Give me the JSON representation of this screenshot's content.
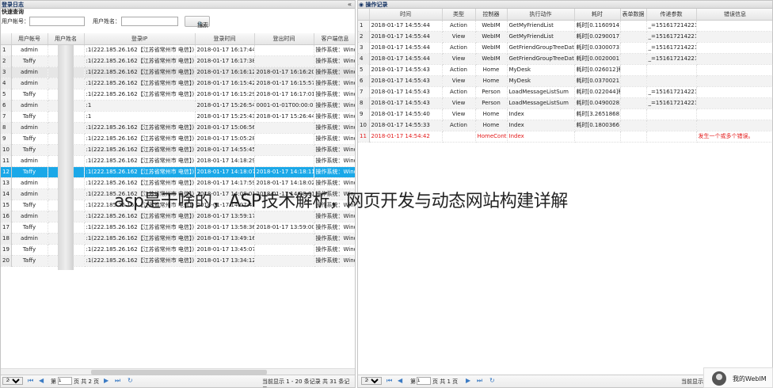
{
  "overlay_caption": "asp是干啥的，ASP技术解析，网页开发与动态网站构建详解",
  "left": {
    "title": "登录日志",
    "collapse_icon": "«",
    "query_title": "快速查询",
    "account_label": "用户帐号：",
    "name_label": "用户姓名：",
    "search_label": "搜索",
    "columns": [
      "",
      "用户帐号",
      "用户姓名",
      "登录IP",
      "登录时间",
      "登出时间",
      "客户端信息"
    ],
    "rows": [
      [
        "1",
        "admin",
        "",
        ":1(222.185.26.162【江苏省常州市 电信】)",
        "2018-01-17 16:17:44",
        "",
        "操作系统：Windo"
      ],
      [
        "2",
        "Taffy",
        "",
        ":1(222.185.26.162【江苏省常州市 电信】)",
        "2018-01-17 16:17:38",
        "",
        "操作系统：Windo"
      ],
      [
        "3",
        "admin",
        "",
        ":1(222.185.26.162【江苏省常州市 电信】)",
        "2018-01-17 16:16:12",
        "2018-01-17 16:16:20",
        "操作系统：Windo"
      ],
      [
        "4",
        "admin",
        "",
        ":1(222.185.26.162【江苏省常州市 电信】)",
        "2018-01-17 16:15:42",
        "2018-01-17 16:15:57",
        "操作系统：Windo"
      ],
      [
        "5",
        "Taffy",
        "",
        ":1(222.185.26.162【江苏省常州市 电信】)",
        "2018-01-17 16:15:29",
        "2018-01-17 16:17:01",
        "操作系统：Windo"
      ],
      [
        "6",
        "admin",
        "",
        ":1",
        "2018-01-17 15:26:54",
        "0001-01-01T00:00:00",
        "操作系统：Windo"
      ],
      [
        "7",
        "Taffy",
        "",
        ":1",
        "2018-01-17 15:25:43",
        "2018-01-17 15:26:44",
        "操作系统：Windo"
      ],
      [
        "8",
        "admin",
        "",
        ":1(222.185.26.162【江苏省常州市 电信】)",
        "2018-01-17 15:06:56",
        "",
        "操作系统：Windo"
      ],
      [
        "9",
        "Taffy",
        "",
        ":1(222.185.26.162【江苏省常州市 电信】)",
        "2018-01-17 15:05:28",
        "",
        "操作系统：Windo"
      ],
      [
        "10",
        "Taffy",
        "",
        ":1(222.185.26.162【江苏省常州市 电信】)",
        "2018-01-17 14:55:45",
        "",
        "操作系统：Windo"
      ],
      [
        "11",
        "admin",
        "",
        ":1(222.185.26.162【江苏省常州市 电信】)",
        "2018-01-17 14:18:29",
        "",
        "操作系统：Windo"
      ],
      [
        "12",
        "Taffy",
        "",
        ":1(222.185.26.162【江苏省常州市 电信】)",
        "2018-01-17 14:18:07",
        "2018-01-17 14:18:11",
        "操作系统：Windo"
      ],
      [
        "13",
        "admin",
        "",
        ":1(222.185.26.162【江苏省常州市 电信】)",
        "2018-01-17 14:17:59",
        "2018-01-17 14:18:02",
        "操作系统：Windo"
      ],
      [
        "14",
        "admin",
        "",
        ":1(222.185.26.162【江苏省常州市 电信】)",
        "2018-01-17 14:08:01",
        "2018-01-17 14:08:01",
        "操作系统：Windo"
      ],
      [
        "15",
        "Taffy",
        "",
        ":1(222.185.26.162【江苏省常州市 电信】)",
        "2018-01-17 14:07:43",
        "",
        "操作系统：Windo"
      ],
      [
        "16",
        "admin",
        "",
        ":1(222.185.26.162【江苏省常州市 电信】)",
        "2018-01-17 13:59:17",
        "",
        "操作系统：Windo"
      ],
      [
        "17",
        "Taffy",
        "",
        ":1(222.185.26.162【江苏省常州市 电信】)",
        "2018-01-17 13:58:36",
        "2018-01-17 13:59:00",
        "操作系统：Windo"
      ],
      [
        "18",
        "admin",
        "",
        ":1(222.185.26.162【江苏省常州市 电信】)",
        "2018-01-17 13:49:16",
        "",
        "操作系统：Windo"
      ],
      [
        "19",
        "Taffy",
        "",
        ":1(222.185.26.162【江苏省常州市 电信】)",
        "2018-01-17 13:45:07",
        "",
        "操作系统：Windo"
      ],
      [
        "20",
        "Taffy",
        "",
        ":1(222.185.26.162【江苏省常州市 电信】)",
        "2018-01-17 13:34:12",
        "",
        "操作系统：Windo"
      ]
    ],
    "selected_row": 12,
    "pager": {
      "page_size": "20 ▾",
      "page_label": "第",
      "page_value": "1",
      "of_pages": "页 共 2 页",
      "display": "当前显示 1 - 20 条记录 共 31 条记录"
    }
  },
  "right": {
    "title": "操作记录",
    "columns": [
      "",
      "时间",
      "类型",
      "控制器",
      "执行动作",
      "耗时",
      "表单数据",
      "传递参数",
      "错误信息"
    ],
    "rows": [
      [
        "1",
        "2018-01-17 14:55:44",
        "Action",
        "WebIM",
        "GetMyFriendList",
        "耗时[0.1160914]秒",
        "",
        "_=1516172142214",
        ""
      ],
      [
        "2",
        "2018-01-17 14:55:44",
        "View",
        "WebIM",
        "GetMyFriendList",
        "耗时[0.0290017]秒",
        "",
        "_=1516172142214",
        ""
      ],
      [
        "3",
        "2018-01-17 14:55:44",
        "Action",
        "WebIM",
        "GetFriendGroupTreeData",
        "耗时[0.0300073]秒",
        "",
        "_=1516172142217",
        ""
      ],
      [
        "4",
        "2018-01-17 14:55:44",
        "View",
        "WebIM",
        "GetFriendGroupTreeData",
        "耗时[0.0020001]秒",
        "",
        "_=1516172142217",
        ""
      ],
      [
        "5",
        "2018-01-17 14:55:43",
        "Action",
        "Home",
        "MyDesk",
        "耗时[0.026012]秒",
        "",
        "",
        ""
      ],
      [
        "6",
        "2018-01-17 14:55:43",
        "View",
        "Home",
        "MyDesk",
        "耗时[0.0370021]秒",
        "",
        "",
        ""
      ],
      [
        "7",
        "2018-01-17 14:55:43",
        "Action",
        "Person",
        "LoadMessageListSum",
        "耗时[0.022044]秒",
        "",
        "_=1516172142213",
        ""
      ],
      [
        "8",
        "2018-01-17 14:55:43",
        "View",
        "Person",
        "LoadMessageListSum",
        "耗时[0.0490028]秒",
        "",
        "_=1516172142213",
        ""
      ],
      [
        "9",
        "2018-01-17 14:55:40",
        "View",
        "Home",
        "Index",
        "耗时[3.2651868]秒",
        "",
        "",
        ""
      ],
      [
        "10",
        "2018-01-17 14:55:33",
        "Action",
        "Home",
        "Index",
        "耗时[0.1800366]秒",
        "",
        "",
        ""
      ],
      [
        "11",
        "2018-01-17 14:54:42",
        "",
        "HomeContro",
        "Index",
        "",
        "",
        "",
        "发生一个或多个错误。"
      ]
    ],
    "error_row": 11,
    "pager": {
      "page_size": "20 ▾",
      "page_label": "第",
      "page_value": "1",
      "of_pages": "页 共 1 页",
      "display": "当前显示"
    }
  },
  "webim": {
    "label": "我的WebIM"
  }
}
